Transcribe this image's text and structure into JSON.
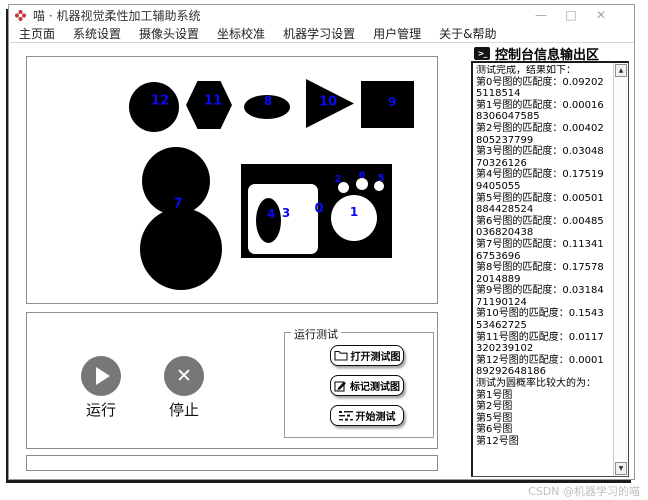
{
  "window": {
    "title": "喵 · 机器视觉柔性加工辅助系统",
    "minimize": "—",
    "maximize": "□",
    "close": "✕"
  },
  "menu": {
    "items": [
      "主页面",
      "系统设置",
      "摄像头设置",
      "坐标校准",
      "机器学习设置",
      "用户管理",
      "关于&帮助"
    ]
  },
  "canvas": {
    "labels": {
      "big_circle": "12",
      "hexagon": "11",
      "ellipse": "8",
      "triangle": "10",
      "square": "9",
      "double_circle": "7",
      "tray": "0",
      "tray_ellipse": "4",
      "tray_ellipse_side": "3",
      "tray_circle": "1",
      "tray_small_left": "2",
      "tray_small_mid": "6",
      "tray_small_right": "5"
    }
  },
  "controls": {
    "run_label": "运行",
    "stop_label": "停止"
  },
  "test_group": {
    "title": "运行测试",
    "open_button": "打开测试图",
    "mark_button": "标记测试图",
    "start_button": "开始测试"
  },
  "console": {
    "title": "控制台信息输出区",
    "icon_glyph": ">_",
    "scroll_up": "▲",
    "scroll_down": "▼",
    "lines": [
      "测试完成，结果如下：",
      "第0号图的匹配度：0.092025118514",
      "第1号图的匹配度：0.000168306047585",
      "第2号图的匹配度：0.00402805237799",
      "第3号图的匹配度：0.0304870326126",
      "第4号图的匹配度：0.175199405055",
      "第5号图的匹配度：0.00501884428524",
      "第6号图的匹配度：0.00485036820438",
      "第7号图的匹配度：0.113416753696",
      "第8号图的匹配度：0.175782014889",
      "第9号图的匹配度：0.0318471190124",
      "第10号图的匹配度：0.154353462725",
      "第11号图的匹配度：0.0117320239102",
      "第12号图的匹配度：0.000189292648186",
      "测试为圆概率比较大的为：",
      "第1号图",
      "第2号图",
      "第5号图",
      "第6号图",
      "第12号图"
    ]
  },
  "watermark": "CSDN @机器学习的喵",
  "colors": {
    "label_blue": "#0a0af0",
    "shape_black": "#000000",
    "circle_button_gray": "#777777",
    "app_icon_red": "#c03a3a",
    "watermark_gray": "#bfbfbf"
  }
}
